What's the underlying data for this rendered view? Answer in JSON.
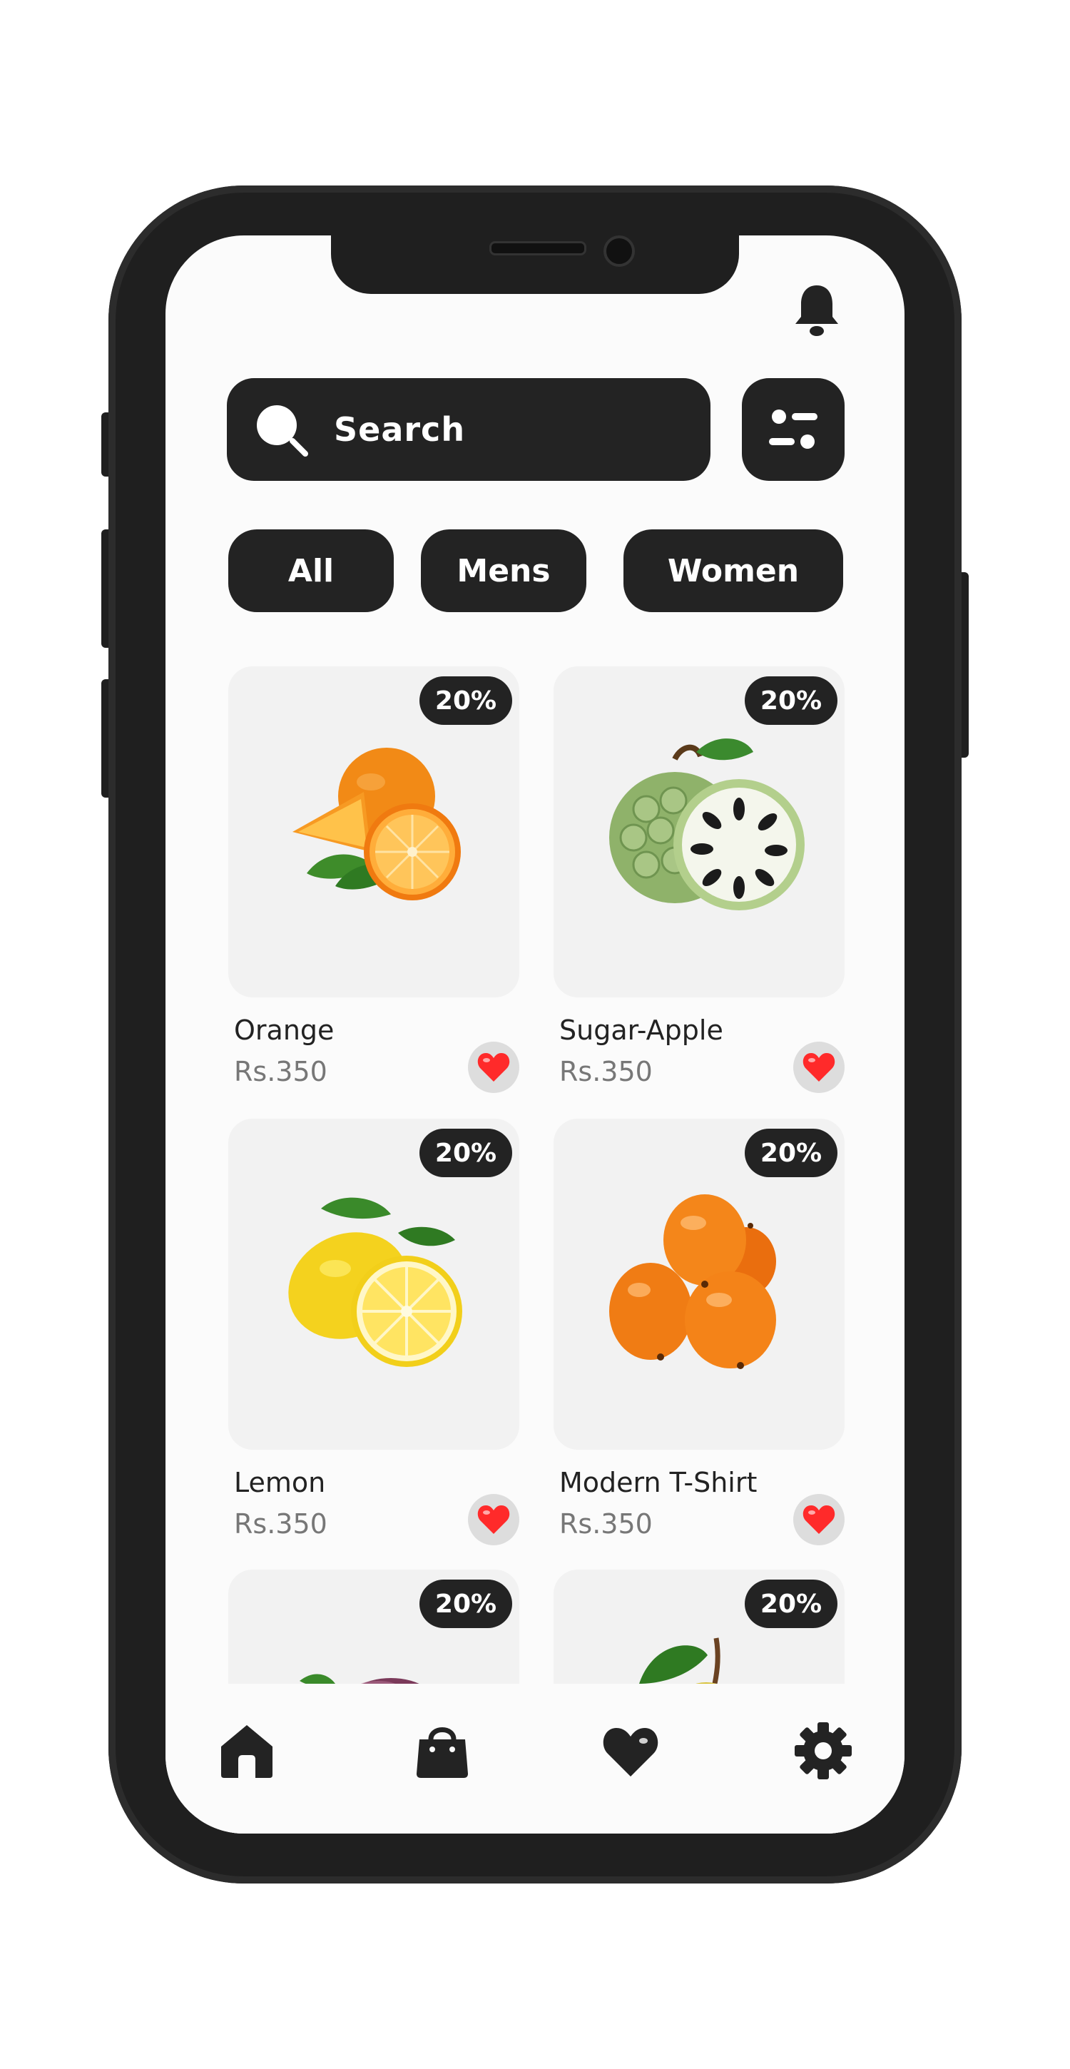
{
  "search": {
    "placeholder": "Search"
  },
  "categories": [
    {
      "label": "All"
    },
    {
      "label": "Mens"
    },
    {
      "label": "Women"
    }
  ],
  "products": [
    {
      "name": "Orange",
      "price": "Rs.350",
      "discount": "20%",
      "image": "orange-image"
    },
    {
      "name": "Sugar-Apple",
      "price": "Rs.350",
      "discount": "20%",
      "image": "sugar-apple-image"
    },
    {
      "name": "Lemon",
      "price": "Rs.350",
      "discount": "20%",
      "image": "lemon-image"
    },
    {
      "name": "Modern T-Shirt",
      "price": "Rs.350",
      "discount": "20%",
      "image": "sea-buckthorn-image"
    },
    {
      "discount": "20%",
      "image": "plum-image"
    },
    {
      "discount": "20%",
      "image": "pear-image"
    }
  ],
  "icons": {
    "notification": "bell-icon",
    "search": "search-icon",
    "filter": "filter-icon",
    "favorite": "heart-icon",
    "nav": [
      "home-icon",
      "bag-icon",
      "heart-icon",
      "gear-icon"
    ]
  },
  "colors": {
    "dark": "#232323",
    "screen": "#fbfbfb",
    "card": "#f2f2f2",
    "heart": "#ff2a2a",
    "price": "#777777"
  }
}
